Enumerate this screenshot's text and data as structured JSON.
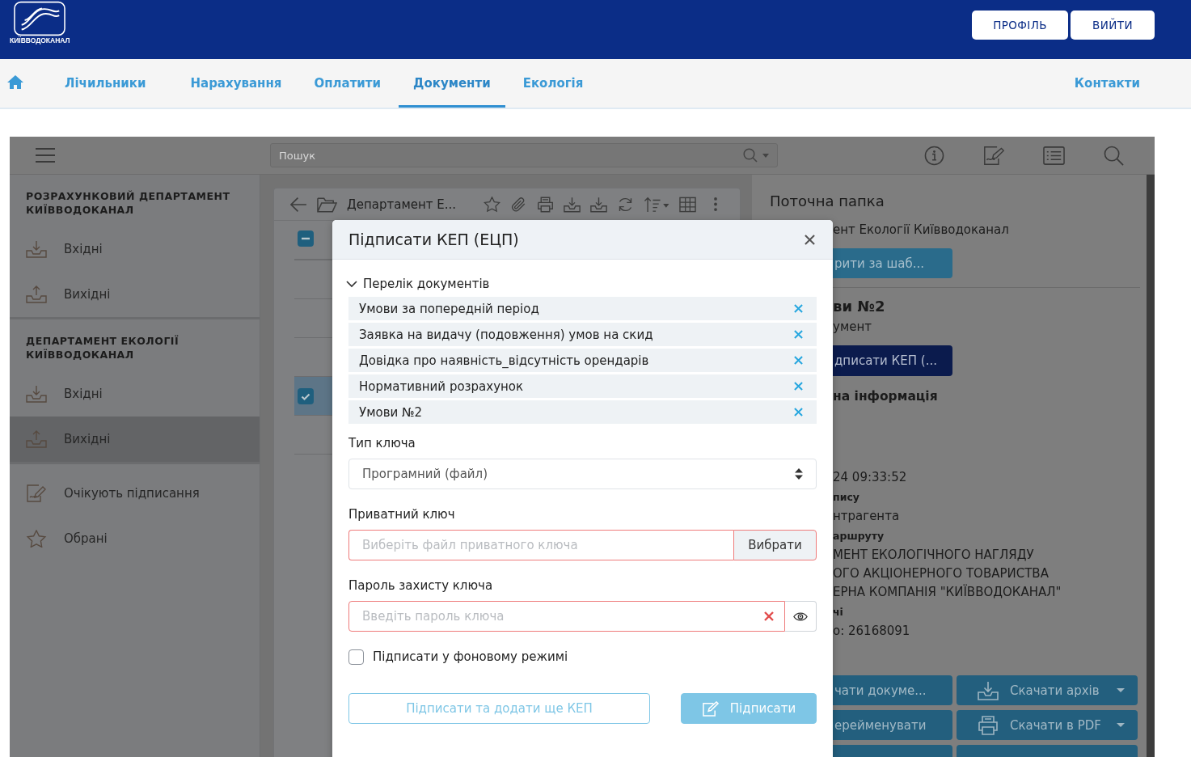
{
  "header": {
    "logo_text": "КИЇВВОДОКАНАЛ",
    "buttons": [
      "ПРОФІЛЬ",
      "ВИЙТИ"
    ]
  },
  "nav": {
    "items": [
      {
        "label": "Лічильники",
        "selected": false
      },
      {
        "label": "Нарахування",
        "selected": false
      },
      {
        "label": "Оплатити",
        "selected": false
      },
      {
        "label": "Документи",
        "selected": true
      },
      {
        "label": "Екологія",
        "selected": false
      }
    ],
    "contacts": "Контакти"
  },
  "toolbar": {
    "search": {
      "placeholder": "Пошук"
    }
  },
  "sidebar": {
    "sections": [
      {
        "title": "РОЗРАХУНКОВИЙ ДЕПАРТАМЕНТ КИЇВВОДОКАНАЛ",
        "items": [
          {
            "label": "Вхідні",
            "kind": "incoming",
            "selected": false
          },
          {
            "label": "Вихідні",
            "kind": "outgoing",
            "selected": false
          }
        ]
      },
      {
        "title": "ДЕПАРТАМЕНТ ЕКОЛОГІЇ КИЇВВОДОКАНАЛ",
        "items": [
          {
            "label": "Вхідні",
            "kind": "incoming",
            "selected": false
          },
          {
            "label": "Вихідні",
            "kind": "outgoing",
            "selected": true
          }
        ]
      }
    ],
    "items": [
      {
        "label": "Очікують підписання",
        "kind": "signing",
        "selected": false
      },
      {
        "label": "Обрані",
        "kind": "favorites",
        "selected": false
      }
    ]
  },
  "list": {
    "folder": "Департамент Е...",
    "select_all": {
      "indeterminate": true
    },
    "rows": [
      {
        "selected": false
      },
      {
        "selected": false
      },
      {
        "selected": false
      },
      {
        "selected": true
      },
      {
        "selected": false
      }
    ]
  },
  "details": {
    "title": "Поточна папка",
    "folder_name": "ент Екології Київводоканал",
    "template_button": "рити за шаб...",
    "document_title": "ви №2",
    "document_type": "умент",
    "sign_button": "дписати КЕП (...",
    "section_title": "на інформація",
    "fields": [
      {
        "kind": "value",
        "text": "24 09:33:52"
      },
      {
        "kind": "label",
        "text": "пису"
      },
      {
        "kind": "value",
        "text": "нтрагента"
      },
      {
        "kind": "label",
        "text": "аршруту"
      },
      {
        "kind": "value",
        "text": "МЕНТ ЕКОЛОГІЧНОГО НАГЛЯДУ"
      },
      {
        "kind": "value",
        "text": "ОГО АКЦІОНЕРНОГО ТОВАРИСТВА"
      },
      {
        "kind": "value",
        "text": "ЕРНА КОМПАНІЯ \"КИЇВВОДОКАНАЛ\""
      },
      {
        "kind": "label",
        "text": "чі"
      },
      {
        "kind": "value",
        "text": "о: 26168091"
      }
    ],
    "actions": [
      {
        "label": "чати докуме...",
        "kind": "plain",
        "dropdown": false
      },
      {
        "label": "Скачати архів",
        "kind": "download",
        "dropdown": true
      },
      {
        "label": "ерейменувати",
        "kind": "plain",
        "dropdown": false
      },
      {
        "label": "Скачати в PDF",
        "kind": "print",
        "dropdown": true
      }
    ]
  },
  "modal": {
    "title": "Підписати КЕП (ЕЦП)",
    "documents": {
      "title": "Перелік документів",
      "expanded": true,
      "items": [
        "Умови за попередній період",
        "Заявка на видачу (подовження) умов на скид",
        "Довідка про наявність_відсутність орендарів",
        "Нормативний розрахунок",
        "Умови №2"
      ]
    },
    "key_type": {
      "label": "Тип ключа",
      "value": "Програмний (файл)"
    },
    "private_key": {
      "label": "Приватний ключ",
      "placeholder": "Виберіть файл приватного ключа",
      "button": "Вибрати",
      "invalid": true
    },
    "password": {
      "label": "Пароль захисту ключа",
      "placeholder": "Введіть пароль ключа",
      "invalid": true
    },
    "background_mode": {
      "label": "Підписати у фоновому режимі",
      "checked": false
    },
    "buttons": [
      {
        "label": "Підписати та додати ще КЕП",
        "kind": "outline",
        "disabled": true
      },
      {
        "label": "Підписати",
        "kind": "primary",
        "disabled": true
      }
    ]
  }
}
